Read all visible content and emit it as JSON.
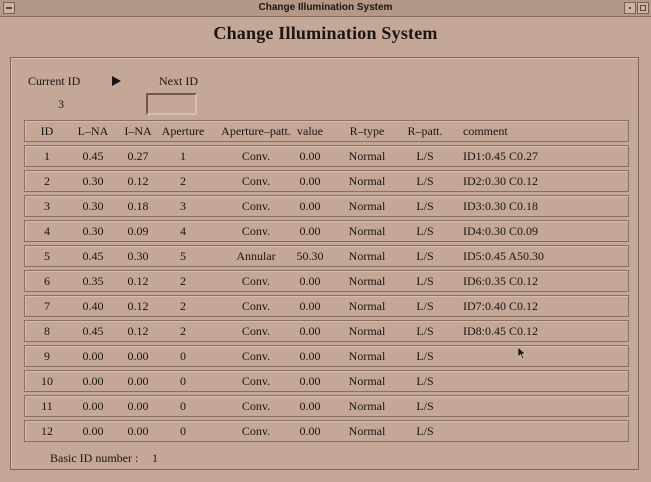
{
  "window": {
    "title": "Change Illumination System"
  },
  "heading": "Change Illumination System",
  "current_id": {
    "label": "Current ID",
    "value": "3"
  },
  "next_id": {
    "label": "Next ID",
    "value": ""
  },
  "table": {
    "headers": {
      "id": "ID",
      "lna": "L–NA",
      "ina": "I–NA",
      "aperture": "Aperture",
      "aperture_patt": "Aperture–patt.",
      "value": "value",
      "r_type": "R–type",
      "r_patt": "R–patt.",
      "comment": "comment"
    },
    "rows": [
      {
        "id": "1",
        "lna": "0.45",
        "ina": "0.27",
        "aperture": "1",
        "aperture_patt": "Conv.",
        "value": "0.00",
        "r_type": "Normal",
        "r_patt": "L/S",
        "comment": "ID1:0.45 C0.27"
      },
      {
        "id": "2",
        "lna": "0.30",
        "ina": "0.12",
        "aperture": "2",
        "aperture_patt": "Conv.",
        "value": "0.00",
        "r_type": "Normal",
        "r_patt": "L/S",
        "comment": "ID2:0.30 C0.12"
      },
      {
        "id": "3",
        "lna": "0.30",
        "ina": "0.18",
        "aperture": "3",
        "aperture_patt": "Conv.",
        "value": "0.00",
        "r_type": "Normal",
        "r_patt": "L/S",
        "comment": "ID3:0.30 C0.18"
      },
      {
        "id": "4",
        "lna": "0.30",
        "ina": "0.09",
        "aperture": "4",
        "aperture_patt": "Conv.",
        "value": "0.00",
        "r_type": "Normal",
        "r_patt": "L/S",
        "comment": "ID4:0.30 C0.09"
      },
      {
        "id": "5",
        "lna": "0.45",
        "ina": "0.30",
        "aperture": "5",
        "aperture_patt": "Annular",
        "value": "50.30",
        "r_type": "Normal",
        "r_patt": "L/S",
        "comment": "ID5:0.45 A50.30"
      },
      {
        "id": "6",
        "lna": "0.35",
        "ina": "0.12",
        "aperture": "2",
        "aperture_patt": "Conv.",
        "value": "0.00",
        "r_type": "Normal",
        "r_patt": "L/S",
        "comment": "ID6:0.35 C0.12"
      },
      {
        "id": "7",
        "lna": "0.40",
        "ina": "0.12",
        "aperture": "2",
        "aperture_patt": "Conv.",
        "value": "0.00",
        "r_type": "Normal",
        "r_patt": "L/S",
        "comment": "ID7:0.40 C0.12"
      },
      {
        "id": "8",
        "lna": "0.45",
        "ina": "0.12",
        "aperture": "2",
        "aperture_patt": "Conv.",
        "value": "0.00",
        "r_type": "Normal",
        "r_patt": "L/S",
        "comment": "ID8:0.45 C0.12"
      },
      {
        "id": "9",
        "lna": "0.00",
        "ina": "0.00",
        "aperture": "0",
        "aperture_patt": "Conv.",
        "value": "0.00",
        "r_type": "Normal",
        "r_patt": "L/S",
        "comment": ""
      },
      {
        "id": "10",
        "lna": "0.00",
        "ina": "0.00",
        "aperture": "0",
        "aperture_patt": "Conv.",
        "value": "0.00",
        "r_type": "Normal",
        "r_patt": "L/S",
        "comment": ""
      },
      {
        "id": "11",
        "lna": "0.00",
        "ina": "0.00",
        "aperture": "0",
        "aperture_patt": "Conv.",
        "value": "0.00",
        "r_type": "Normal",
        "r_patt": "L/S",
        "comment": ""
      },
      {
        "id": "12",
        "lna": "0.00",
        "ina": "0.00",
        "aperture": "0",
        "aperture_patt": "Conv.",
        "value": "0.00",
        "r_type": "Normal",
        "r_patt": "L/S",
        "comment": ""
      }
    ]
  },
  "footer": {
    "basic_id_label": "Basic ID number :",
    "basic_id_value": "1"
  },
  "icons": {
    "arrow": "right-arrow-icon",
    "cursor": "mouse-pointer-icon"
  },
  "colors": {
    "background": "#c4a797",
    "titlebar": "#b49887",
    "text": "#1a1412"
  }
}
